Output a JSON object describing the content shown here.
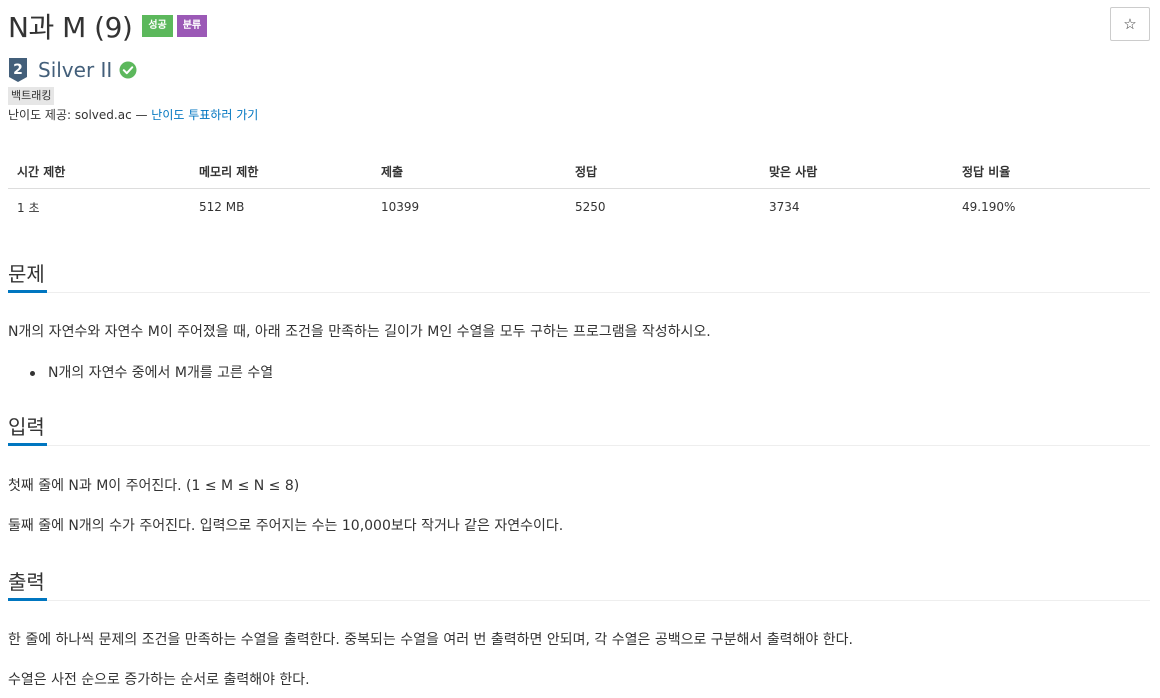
{
  "problem": {
    "title": "N과 M (9)",
    "badges": {
      "success": "성공",
      "category": "분류"
    },
    "star_icon": "☆",
    "tier": {
      "number": "2",
      "label": "Silver II",
      "color": "#435f7a"
    },
    "tag": "백트래킹",
    "provider_prefix": "난이도 제공: solved.ac — ",
    "provider_link": "난이도 투표하러 가기"
  },
  "stats": {
    "headers": [
      "시간 제한",
      "메모리 제한",
      "제출",
      "정답",
      "맞은 사람",
      "정답 비율"
    ],
    "values": [
      "1 초",
      "512 MB",
      "10399",
      "5250",
      "3734",
      "49.190%"
    ]
  },
  "sections": {
    "problem": {
      "heading": "문제",
      "text": "N개의 자연수와 자연수 M이 주어졌을 때, 아래 조건을 만족하는 길이가 M인 수열을 모두 구하는 프로그램을 작성하시오.",
      "bullets": [
        "N개의 자연수 중에서 M개를 고른 수열"
      ]
    },
    "input": {
      "heading": "입력",
      "lines": [
        "첫째 줄에 N과 M이 주어진다. (1 ≤ M ≤ N ≤ 8)",
        "둘째 줄에 N개의 수가 주어진다. 입력으로 주어지는 수는 10,000보다 작거나 같은 자연수이다."
      ]
    },
    "output": {
      "heading": "출력",
      "lines": [
        "한 줄에 하나씩 문제의 조건을 만족하는 수열을 출력한다. 중복되는 수열을 여러 번 출력하면 안되며, 각 수열은 공백으로 구분해서 출력해야 한다.",
        "수열은 사전 순으로 증가하는 순서로 출력해야 한다."
      ]
    }
  },
  "colors": {
    "accent": "#0076c0",
    "success": "#5cb85c",
    "category": "#9b59b6"
  }
}
